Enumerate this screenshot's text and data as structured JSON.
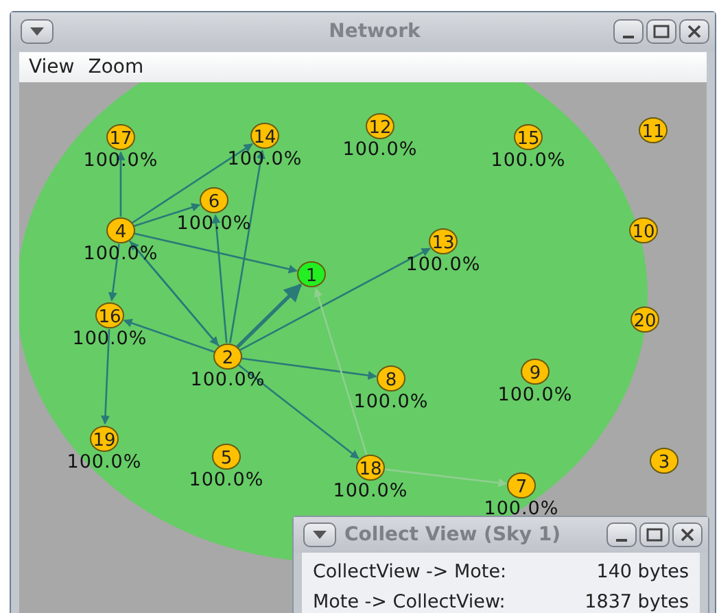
{
  "window": {
    "title": "Network"
  },
  "menu": [
    "View",
    "Zoom"
  ],
  "nodes": [
    {
      "id": "17",
      "kind": "mote",
      "reading": "100.0%"
    },
    {
      "id": "14",
      "kind": "mote",
      "reading": "100.0%"
    },
    {
      "id": "12",
      "kind": "mote",
      "reading": "100.0%"
    },
    {
      "id": "15",
      "kind": "mote",
      "reading": "100.0%"
    },
    {
      "id": "11",
      "kind": "mote"
    },
    {
      "id": "6",
      "kind": "mote",
      "reading": "100.0%"
    },
    {
      "id": "4",
      "kind": "mote",
      "reading": "100.0%"
    },
    {
      "id": "13",
      "kind": "mote",
      "reading": "100.0%"
    },
    {
      "id": "1",
      "kind": "sink"
    },
    {
      "id": "10",
      "kind": "mote"
    },
    {
      "id": "16",
      "kind": "mote",
      "reading": "100.0%"
    },
    {
      "id": "2",
      "kind": "mote",
      "reading": "100.0%"
    },
    {
      "id": "20",
      "kind": "mote"
    },
    {
      "id": "8",
      "kind": "mote",
      "reading": "100.0%"
    },
    {
      "id": "9",
      "kind": "mote",
      "reading": "100.0%"
    },
    {
      "id": "19",
      "kind": "mote",
      "reading": "100.0%"
    },
    {
      "id": "5",
      "kind": "mote",
      "reading": "100.0%"
    },
    {
      "id": "18",
      "kind": "mote",
      "reading": "100.0%"
    },
    {
      "id": "7",
      "kind": "mote",
      "reading": "100.0%"
    },
    {
      "id": "3",
      "kind": "mote"
    }
  ],
  "collect_view": {
    "title": "Collect View (Sky 1)",
    "rows": [
      {
        "label": "CollectView -> Mote:",
        "value": "140 bytes"
      },
      {
        "label": "Mote -> CollectView:",
        "value": "1837 bytes"
      }
    ]
  }
}
